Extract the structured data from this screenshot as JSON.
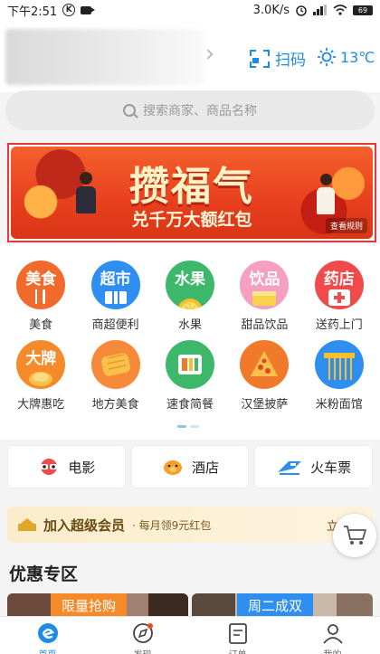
{
  "status_bar": {
    "time": "下午2:51",
    "k_badge": "K",
    "speed": "3.0K/s",
    "battery": "69"
  },
  "header": {
    "scan_label": "扫码",
    "temperature": "13℃"
  },
  "search": {
    "placeholder": "搜索商家、商品名称"
  },
  "banner": {
    "title": "攒福气",
    "subtitle": "兑千万大额红包",
    "tag": "查看规则"
  },
  "categories": [
    {
      "label": "美食",
      "icon_text": "美食",
      "color": "#f26a2b",
      "icon": "food-icon"
    },
    {
      "label": "商超便利",
      "icon_text": "超市",
      "color": "#2e8ff0",
      "icon": "supermarket-icon"
    },
    {
      "label": "水果",
      "icon_text": "水果",
      "color": "#3db86a",
      "icon": "fruit-icon"
    },
    {
      "label": "甜品饮品",
      "icon_text": "饮品",
      "color": "#f5a0c0",
      "icon": "drink-icon"
    },
    {
      "label": "送药上门",
      "icon_text": "药店",
      "color": "#f04a4a",
      "icon": "pharmacy-icon"
    },
    {
      "label": "大牌惠吃",
      "icon_text": "大牌",
      "color": "#f58a2a",
      "icon": "brand-icon"
    },
    {
      "label": "地方美食",
      "icon_text": "",
      "color": "#f78a3a",
      "icon": "local-food-icon"
    },
    {
      "label": "速食简餐",
      "icon_text": "",
      "color": "#3db86a",
      "icon": "fast-food-icon"
    },
    {
      "label": "汉堡披萨",
      "icon_text": "",
      "color": "#f07a2a",
      "icon": "pizza-icon"
    },
    {
      "label": "米粉面馆",
      "icon_text": "",
      "color": "#2e8ff0",
      "icon": "noodle-icon"
    }
  ],
  "entertainment": [
    {
      "label": "电影",
      "icon": "movie-glasses-icon"
    },
    {
      "label": "酒店",
      "icon": "hotel-pig-icon"
    },
    {
      "label": "火车票",
      "icon": "train-ticket-icon"
    }
  ],
  "member": {
    "title": "加入超级会员",
    "subtitle": "· 每月领9元红包",
    "cta": "立即开"
  },
  "promo": {
    "title": "优惠专区",
    "tag1": "限量抢购",
    "tag2": "周二成双"
  },
  "tabs": [
    {
      "label": "首页",
      "active": true
    },
    {
      "label": "发现",
      "active": false
    },
    {
      "label": "订单",
      "active": false
    },
    {
      "label": "我的",
      "active": false
    }
  ],
  "colors": {
    "accent": "#1e8ce6",
    "banner": "#e8401f",
    "highlight_border": "#e23a3a"
  }
}
